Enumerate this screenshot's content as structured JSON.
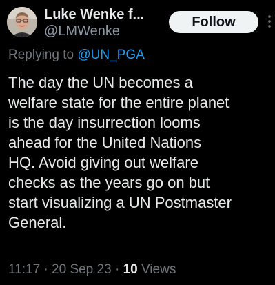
{
  "author": {
    "display_name": "Luke Wenke f...",
    "handle": "@LMWenke"
  },
  "follow_label": "Follow",
  "reply": {
    "prefix": "Replying to ",
    "mention": "@UN_PGA"
  },
  "body_lines": [
    "The day the UN becomes a",
    "welfare state for the entire planet",
    "is the day insurrection looms",
    "ahead for the United Nations",
    "HQ.  Avoid giving out welfare",
    "checks as the years go on but",
    "start visualizing a UN Postmaster",
    "General."
  ],
  "meta": {
    "time": "11:17",
    "sep1": " · ",
    "date": "20 Sep 23",
    "sep2": " · ",
    "views_count": "10",
    "views_label": " Views"
  },
  "colors": {
    "background": "#000000",
    "text": "#e7e9ea",
    "secondary": "#71767b",
    "mention": "#1d9bf0",
    "follow_button": "#eff3f4"
  },
  "icons": {
    "avatar": "avatar-photo",
    "more": "more-vertical-icon"
  }
}
